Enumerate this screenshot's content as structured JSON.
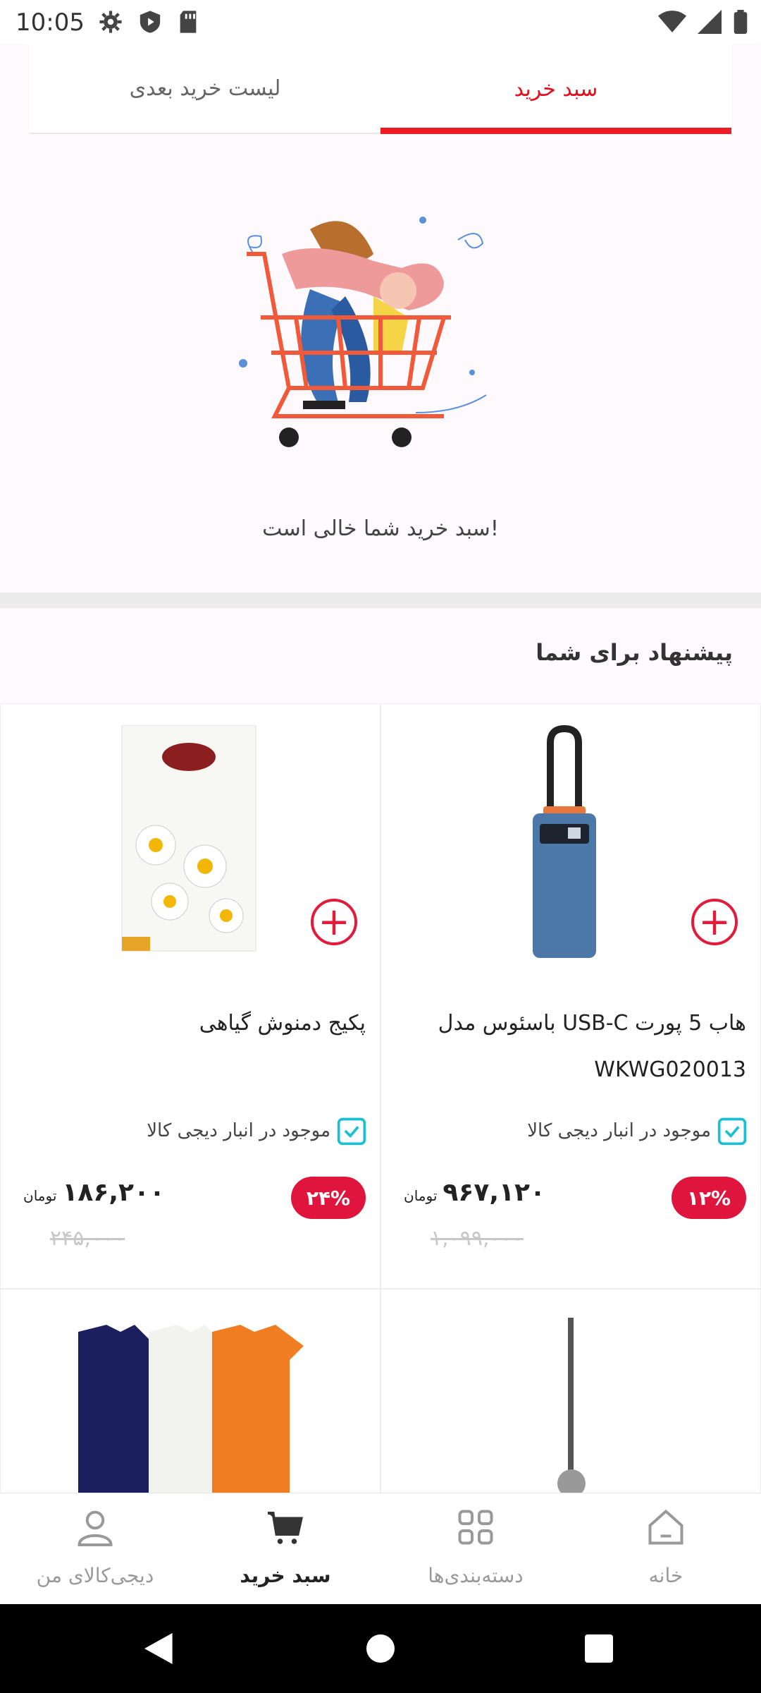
{
  "status_bar": {
    "time": "10:05"
  },
  "tabs": {
    "cart": "سبد خرید",
    "next_list": "لیست خرید بعدی"
  },
  "empty_cart": {
    "message": "سبد خرید شما خالی است!"
  },
  "recommendations": {
    "title": "پیشنهاد برای شما",
    "products": [
      {
        "title": "هاب 5 پورت USB-C باسئوس مدل WKWG020013",
        "stock": "موجود در انبار دیجی کالا",
        "discount": "۱۲%",
        "price": "۹۶۷,۱۲۰",
        "currency": "تومان",
        "old_price": "۱,۰۹۹,۰۰۰"
      },
      {
        "title": "پکیج دمنوش گیاهی",
        "stock": "موجود در انبار دیجی کالا",
        "discount": "۲۴%",
        "price": "۱۸۶,۲۰۰",
        "currency": "تومان",
        "old_price": "۲۴۵,۰۰۰"
      }
    ]
  },
  "bottom_nav": {
    "home": "خانه",
    "categories": "دسته‌بندی‌ها",
    "cart": "سبد خرید",
    "my_digikala": "دیجی‌کالای من"
  },
  "colors": {
    "accent": "#ed1c24",
    "discount": "#e0153e"
  }
}
